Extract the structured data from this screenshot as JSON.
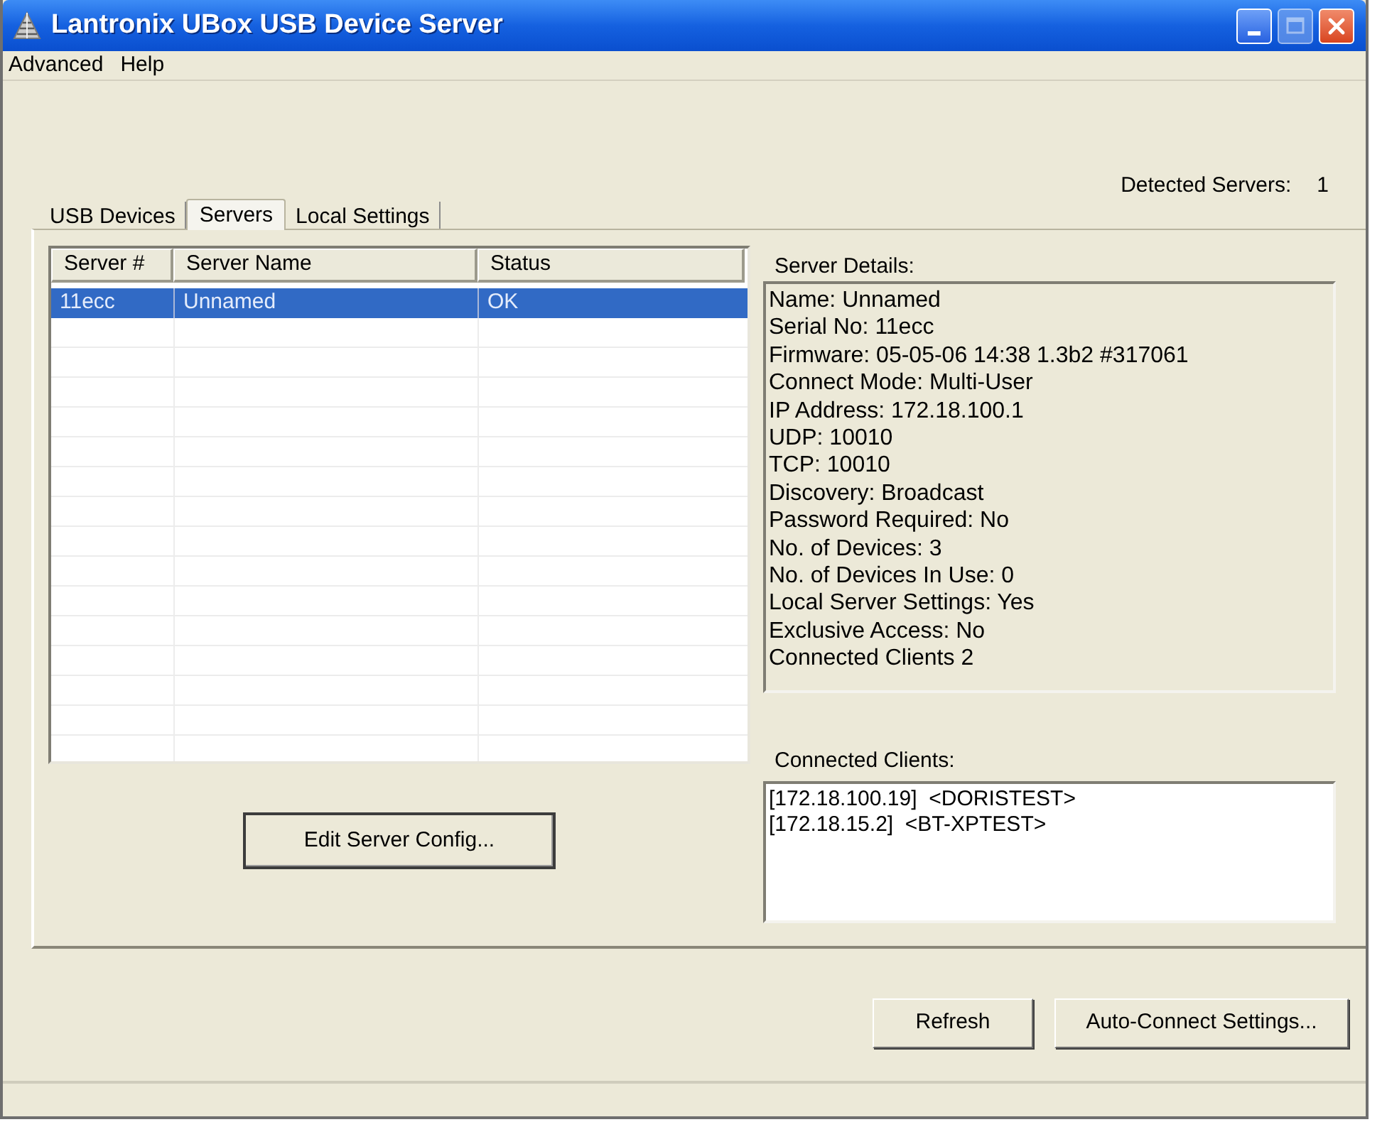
{
  "window": {
    "title": "Lantronix UBox USB Device Server",
    "maximize_disabled": true
  },
  "menu": [
    "Advanced",
    "Help"
  ],
  "detected_servers": {
    "label": "Detected Servers:",
    "value": "1"
  },
  "tabs": [
    {
      "label": "USB Devices",
      "selected": false
    },
    {
      "label": "Servers",
      "selected": true
    },
    {
      "label": "Local Settings",
      "selected": false
    }
  ],
  "server_table": {
    "columns": [
      "Server #",
      "Server Name",
      "Status"
    ],
    "rows": [
      {
        "cells": [
          "11ecc",
          "Unnamed",
          "OK"
        ],
        "selected": true
      }
    ]
  },
  "edit_button": {
    "label": "Edit Server Config...",
    "default": true
  },
  "server_details": {
    "label": "Server Details:",
    "lines": [
      "Name: Unnamed",
      "Serial No: 11ecc",
      "Firmware: 05-05-06 14:38 1.3b2 #317061",
      "Connect Mode: Multi-User",
      "IP Address: 172.18.100.1",
      "UDP: 10010",
      "TCP: 10010",
      "Discovery: Broadcast",
      "Password Required: No",
      "No. of Devices: 3",
      "No. of Devices In Use: 0",
      "Local Server Settings: Yes",
      "Exclusive Access: No",
      "Connected Clients 2"
    ]
  },
  "connected_clients": {
    "label": "Connected Clients:",
    "lines": [
      "[172.18.100.19]  <DORISTEST>",
      "[172.18.15.2]  <BT-XPTEST>"
    ]
  },
  "buttons": [
    {
      "label": "Refresh",
      "default": false
    },
    {
      "label": "Auto-Connect Settings...",
      "default": false
    }
  ]
}
